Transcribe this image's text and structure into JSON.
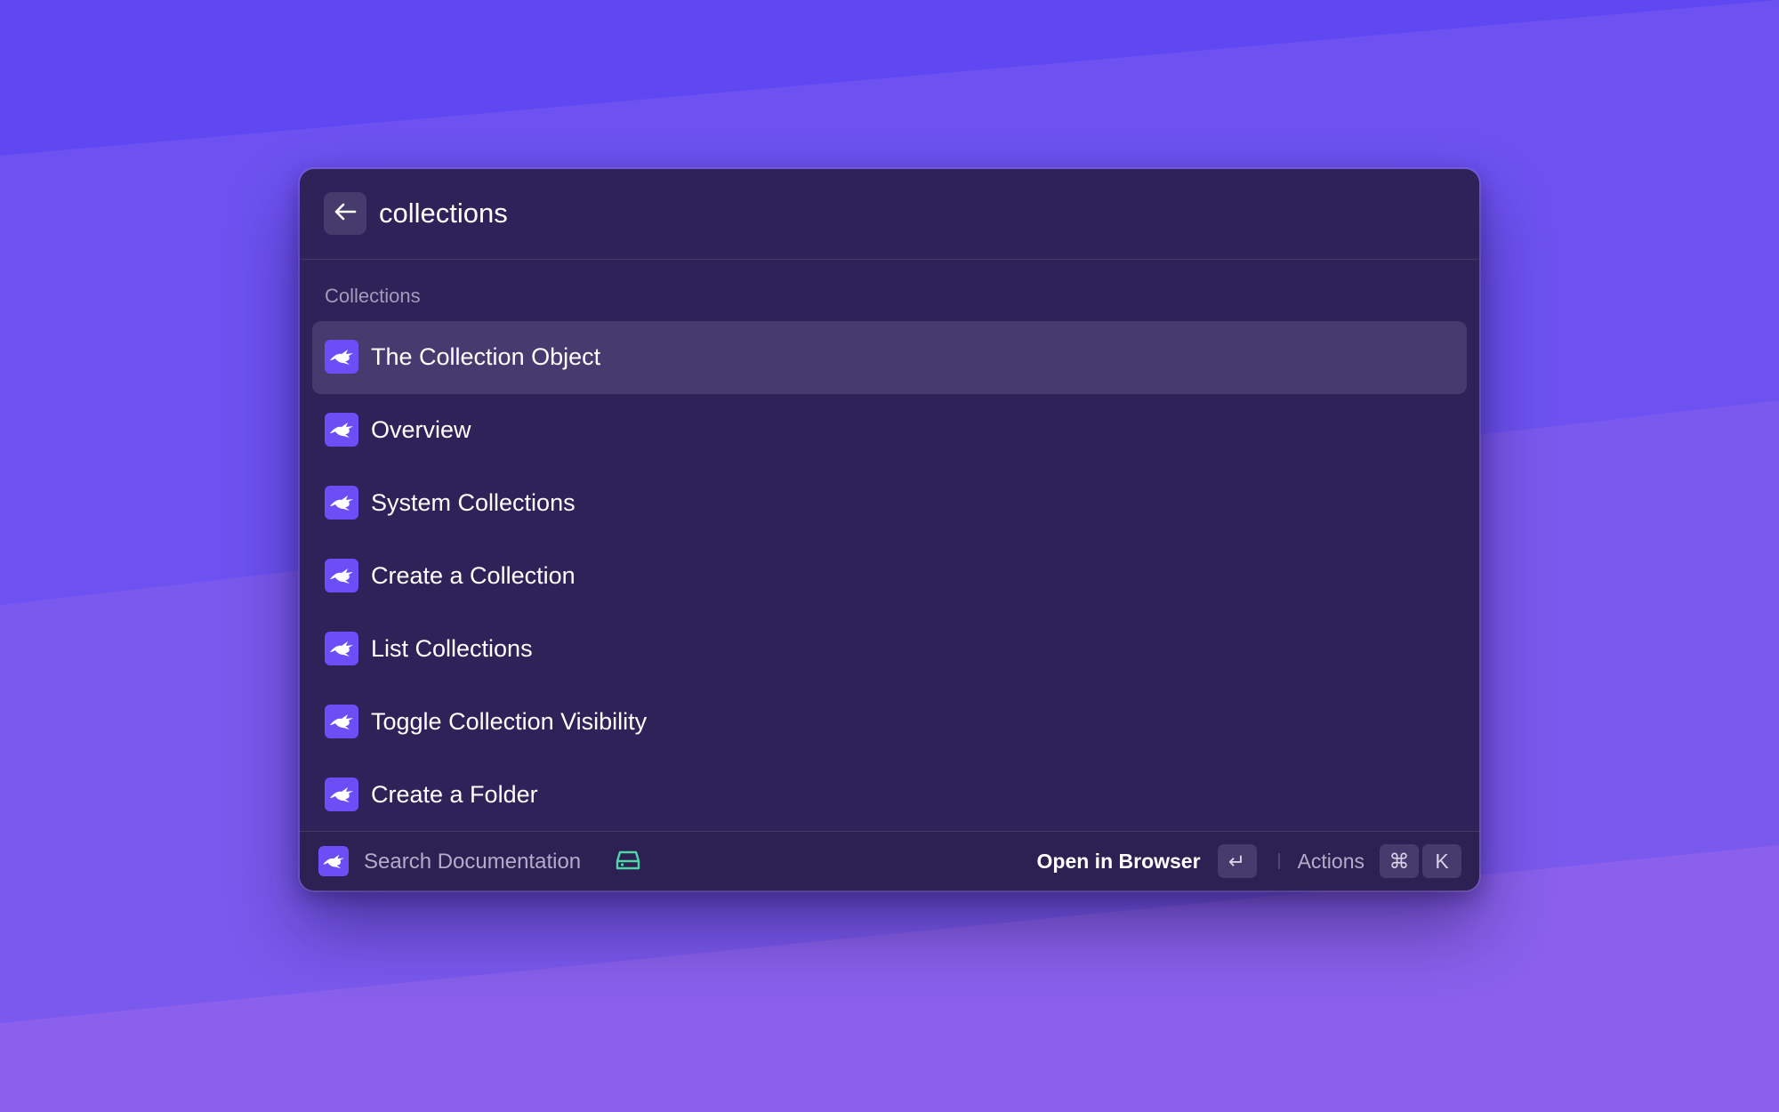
{
  "search": {
    "query": "collections"
  },
  "section": {
    "title": "Collections"
  },
  "results": [
    {
      "label": "The Collection Object",
      "icon": "rabbit-logo-icon",
      "selected": true
    },
    {
      "label": "Overview",
      "icon": "rabbit-logo-icon"
    },
    {
      "label": "System Collections",
      "icon": "rabbit-logo-icon"
    },
    {
      "label": "Create a Collection",
      "icon": "rabbit-logo-icon"
    },
    {
      "label": "List Collections",
      "icon": "rabbit-logo-icon"
    },
    {
      "label": "Toggle Collection Visibility",
      "icon": "rabbit-logo-icon"
    },
    {
      "label": "Create a Folder",
      "icon": "rabbit-logo-icon"
    }
  ],
  "footer": {
    "title": "Search Documentation",
    "primary_action": "Open in Browser",
    "enter_key": "↵",
    "actions_label": "Actions",
    "cmd_key": "⌘",
    "k_key": "K"
  },
  "colors": {
    "background": "#6a4ff0",
    "window": "#2f2258",
    "selected_row": "#463a6e",
    "app_icon": "#6b4ef6",
    "cache_icon": "#4fd6a5"
  }
}
